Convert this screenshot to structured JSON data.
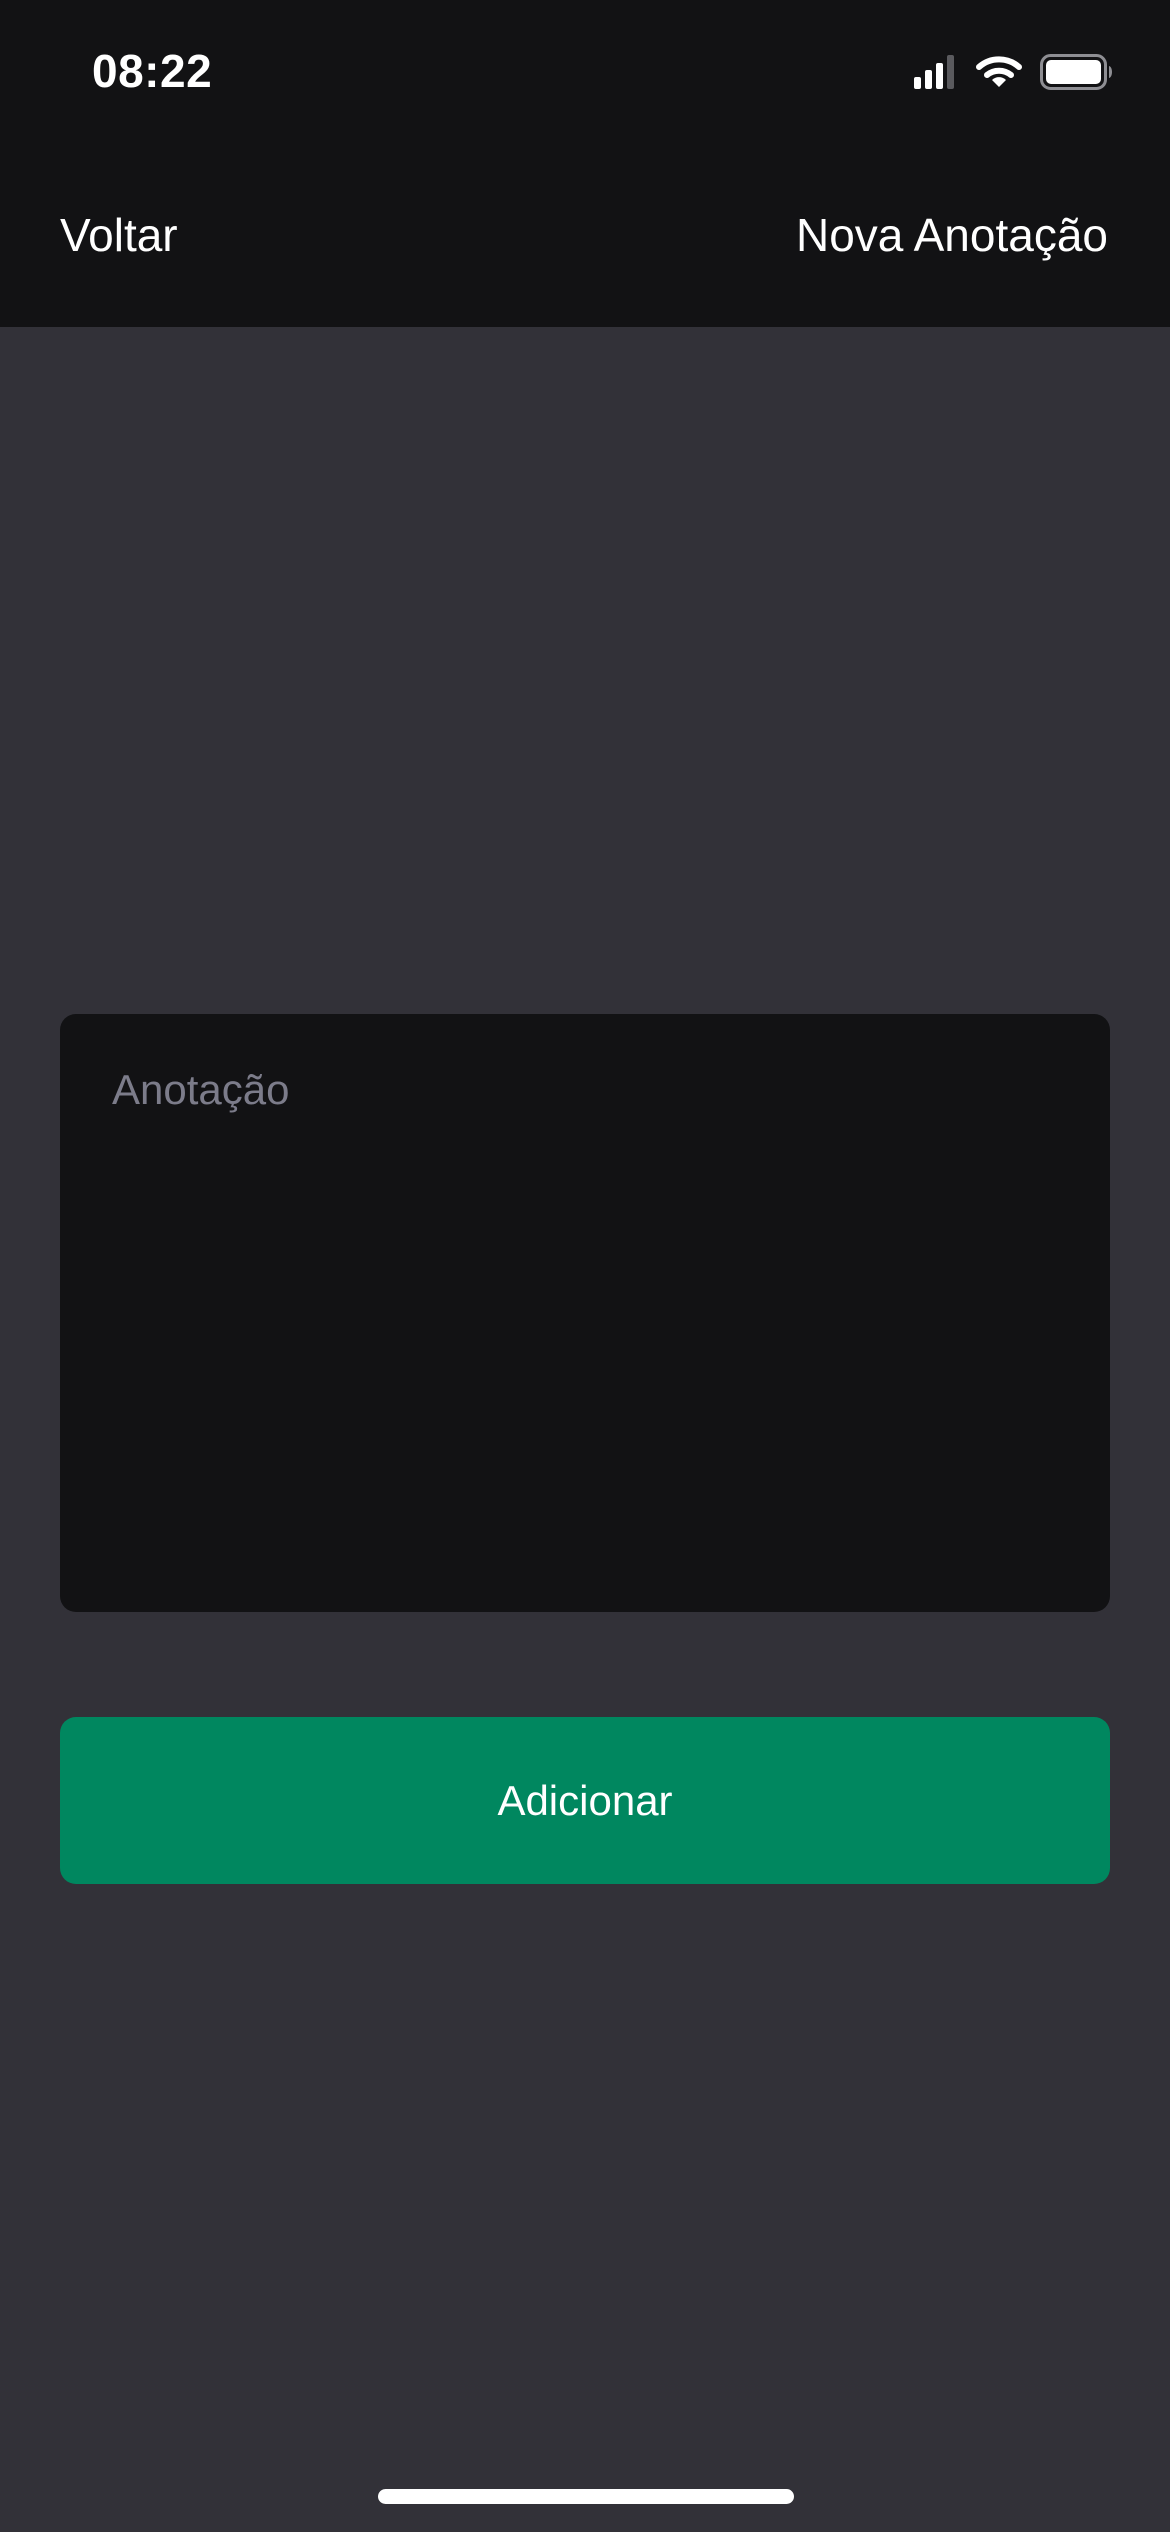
{
  "status_bar": {
    "time": "08:22",
    "icons": [
      "cellular-signal-icon",
      "wifi-icon",
      "battery-icon"
    ],
    "signal_bars_active": 3,
    "signal_bars_total": 4,
    "battery_level": 1.0
  },
  "nav": {
    "back_label": "Voltar",
    "title": "Nova Anotação"
  },
  "form": {
    "note_placeholder": "Anotação",
    "note_value": "",
    "submit_label": "Adicionar"
  },
  "colors": {
    "background": "#323138",
    "header": "#121214",
    "input_background": "#121214",
    "placeholder": "#7c7c8a",
    "accent": "#00875f",
    "text": "#ffffff"
  }
}
